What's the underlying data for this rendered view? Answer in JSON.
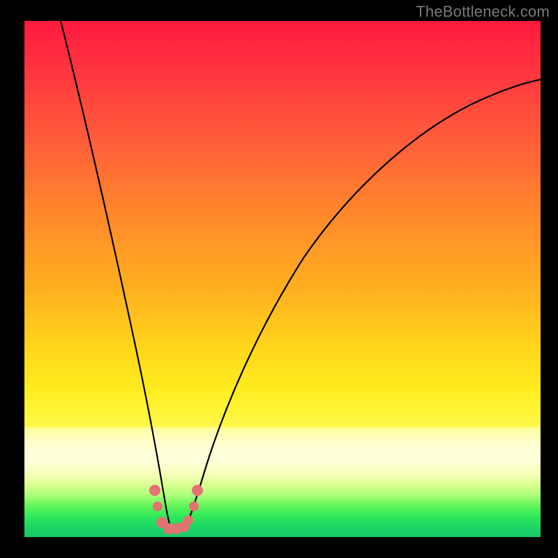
{
  "watermark": "TheBottleneck.com",
  "colors": {
    "background": "#000000",
    "curve": "#000000",
    "marker": "#e27373",
    "gradient_top": "#ff1a3c",
    "gradient_bottom": "#18c864"
  },
  "chart_data": {
    "type": "line",
    "title": "",
    "xlabel": "",
    "ylabel": "",
    "xlim": [
      0,
      100
    ],
    "ylim": [
      0,
      100
    ],
    "grid": false,
    "legend": false,
    "series": [
      {
        "name": "left-curve",
        "x": [
          7,
          9,
          11,
          13,
          15,
          17,
          19,
          21,
          22.5,
          24,
          25.5,
          27
        ],
        "values": [
          100,
          88,
          77,
          66,
          55,
          45,
          35,
          25,
          18,
          12,
          6,
          2
        ]
      },
      {
        "name": "right-curve",
        "x": [
          31,
          33,
          36,
          40,
          45,
          51,
          58,
          66,
          75,
          85,
          95,
          100
        ],
        "values": [
          2,
          6,
          12,
          20,
          30,
          40,
          51,
          62,
          72,
          80,
          86,
          88
        ]
      }
    ],
    "markers": [
      {
        "x": 25.2,
        "y": 9.0
      },
      {
        "x": 25.8,
        "y": 6.0
      },
      {
        "x": 26.6,
        "y": 2.8
      },
      {
        "x": 28.0,
        "y": 1.6
      },
      {
        "x": 29.5,
        "y": 1.6
      },
      {
        "x": 31.0,
        "y": 2.0
      },
      {
        "x": 31.8,
        "y": 3.2
      },
      {
        "x": 32.8,
        "y": 6.0
      },
      {
        "x": 33.5,
        "y": 9.0
      }
    ]
  }
}
